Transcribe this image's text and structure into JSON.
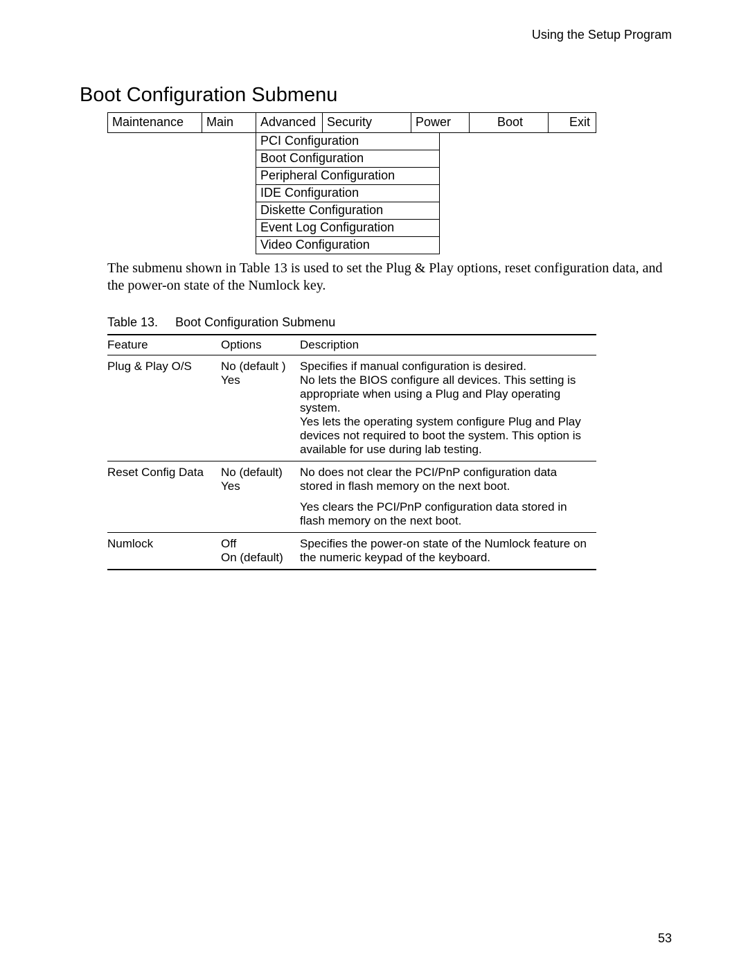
{
  "header": {
    "running": "Using the Setup Program"
  },
  "title": "Boot Configuration Submenu",
  "bios": {
    "tabs": {
      "maintenance": "Maintenance",
      "main": "Main",
      "advanced": "Advanced",
      "security": "Security",
      "power": "Power",
      "boot": "Boot",
      "exit": "Exit"
    },
    "submenu": [
      "PCI Configuration",
      "Boot Configuration",
      "Peripheral Configuration",
      "IDE Configuration",
      "Diskette Configuration",
      "Event Log Configuration",
      "Video Configuration"
    ]
  },
  "body_text": "The submenu shown in Table 13 is used to set the Plug & Play options, reset configuration data, and the power-on state of the Numlock key.",
  "table": {
    "caption_label": "Table 13.",
    "caption_title": "Boot Configuration Submenu",
    "headers": {
      "feature": "Feature",
      "options": "Options",
      "description": "Description"
    },
    "rows": [
      {
        "feature": "Plug & Play O/S",
        "options": [
          "No (default )",
          "Yes"
        ],
        "description": [
          "Specifies if manual configuration is desired.",
          "No lets the BIOS configure all devices.  This setting is appropriate when using a Plug and Play operating system.",
          "Yes lets the operating system configure Plug and Play devices not required to boot the system.  This option is available for use during lab testing."
        ]
      },
      {
        "feature": "Reset Config Data",
        "options": [
          "No (default)",
          "Yes"
        ],
        "description": [
          "No does not clear the PCI/PnP configuration data stored in flash memory on the next boot.",
          "Yes clears the PCI/PnP configuration data stored in flash memory on the next boot."
        ]
      },
      {
        "feature": "Numlock",
        "options": [
          "Off",
          "On (default)"
        ],
        "description": [
          "Specifies the power-on state of the Numlock feature on the numeric keypad of the keyboard."
        ]
      }
    ]
  },
  "page_number": "53"
}
